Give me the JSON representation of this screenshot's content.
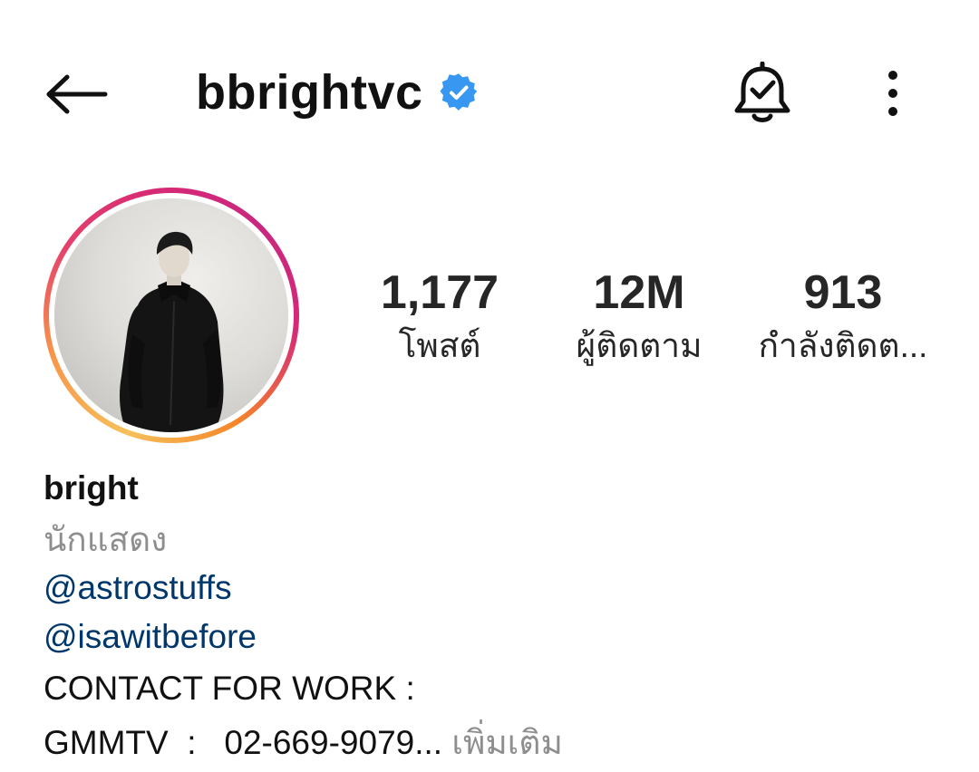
{
  "header": {
    "username": "bbrightvc",
    "verified_icon": "verified-badge-icon",
    "back_icon": "back-arrow-icon",
    "bell_icon": "bell-check-icon",
    "more_icon": "more-vertical-icon",
    "verified_color": "#3897f0"
  },
  "profile": {
    "avatar_ring_colors": [
      "#f58529",
      "#dd2a7b",
      "#f6c05b"
    ]
  },
  "stats": {
    "posts": {
      "value": "1,177",
      "label": "โพสต์"
    },
    "followers": {
      "value": "12M",
      "label": "ผู้ติดตาม"
    },
    "following": {
      "value": "913",
      "label": "กำลังติดต..."
    }
  },
  "bio": {
    "name": "bright",
    "category": "นักแสดง",
    "links": [
      "@astrostuffs",
      "@isawitbefore"
    ],
    "line1": "CONTACT FOR WORK :",
    "line2": "GMMTV  :   02-669-9079...",
    "more": " เพิ่มเติม",
    "link_color": "#00376b",
    "muted_color": "#8e8e8e"
  }
}
